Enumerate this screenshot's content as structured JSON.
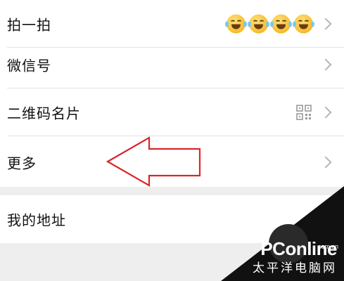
{
  "menu": {
    "items": [
      {
        "label": "拍一拍",
        "accessory": "emoji-faces"
      },
      {
        "label": "微信号",
        "accessory": "none"
      },
      {
        "label": "二维码名片",
        "accessory": "qr-code-icon"
      },
      {
        "label": "更多",
        "accessory": "none"
      }
    ]
  },
  "address": {
    "label": "我的地址"
  },
  "annotation": {
    "arrow_color": "#d9262a",
    "points_to": "更多"
  },
  "watermark": {
    "brand": "PConline",
    "domain": "com.cn",
    "subtitle": "太平洋电脑网"
  },
  "colors": {
    "background": "#eeeeee",
    "row": "#ffffff",
    "chevron": "#b5b5b5",
    "arrow": "#d9262a"
  }
}
